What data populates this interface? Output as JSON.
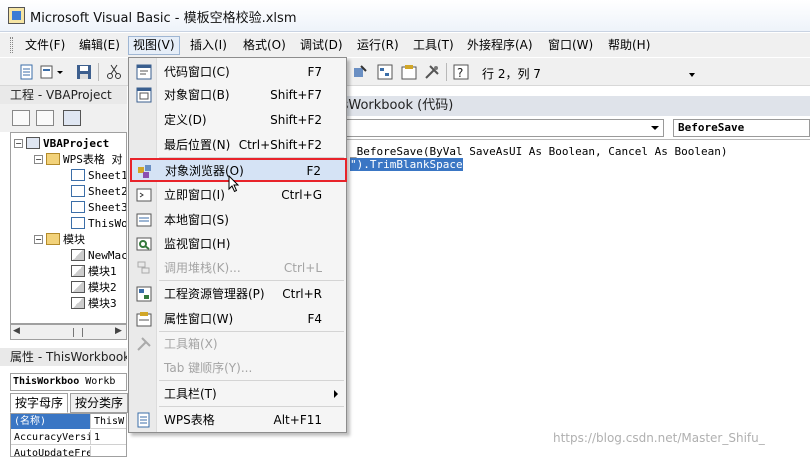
{
  "window": {
    "title": "Microsoft Visual Basic - 模板空格校验.xlsm"
  },
  "menubar": [
    {
      "label": "文件(F)"
    },
    {
      "label": "编辑(E)"
    },
    {
      "label": "视图(V)"
    },
    {
      "label": "插入(I)"
    },
    {
      "label": "格式(O)"
    },
    {
      "label": "调试(D)"
    },
    {
      "label": "运行(R)"
    },
    {
      "label": "工具(T)"
    },
    {
      "label": "外接程序(A)"
    },
    {
      "label": "窗口(W)"
    },
    {
      "label": "帮助(H)"
    }
  ],
  "toolbar": {
    "position_text": "行 2，列 7"
  },
  "project_panel": {
    "title": "工程 - VBAProject",
    "tree": [
      {
        "label": "VBAProject"
      },
      {
        "label": "WPS表格 对"
      },
      {
        "label": "Sheet1"
      },
      {
        "label": "Sheet2"
      },
      {
        "label": "Sheet3"
      },
      {
        "label": "ThisWo"
      },
      {
        "label": "模块"
      },
      {
        "label": "NewMac"
      },
      {
        "label": "模块1"
      },
      {
        "label": "模块2"
      },
      {
        "label": "模块3"
      }
    ]
  },
  "properties_panel": {
    "title": "属性 - ThisWorkbook",
    "object_name": "ThisWorkboo",
    "object_type": "Workb",
    "tabs": [
      "按字母序",
      "按分类序"
    ],
    "rows": [
      {
        "key": "(名称)",
        "value": "ThisW"
      },
      {
        "key": "AccuracyVersi",
        "value": "1"
      },
      {
        "key": "AutoUpdateFreQ",
        "value": ""
      }
    ]
  },
  "code_window": {
    "title": "isWorkbook (代码)",
    "object_combo": "",
    "procedure_combo": "BeforeSave",
    "lines": [
      "_BeforeSave(ByVal SaveAsUI As Boolean, Cancel As Boolean)",
      "\").TrimBlankSpace"
    ]
  },
  "view_menu": {
    "items": [
      {
        "label": "代码窗口(C)",
        "shortcut": "F7",
        "icon": "code-window-icon"
      },
      {
        "label": "对象窗口(B)",
        "shortcut": "Shift+F7",
        "icon": "object-window-icon"
      },
      {
        "label": "定义(D)",
        "shortcut": "Shift+F2",
        "icon": ""
      },
      {
        "label": "最后位置(N)",
        "shortcut": "Ctrl+Shift+F2",
        "icon": ""
      },
      {
        "label": "对象浏览器(O)",
        "shortcut": "F2",
        "icon": "object-browser-icon"
      },
      {
        "label": "立即窗口(I)",
        "shortcut": "Ctrl+G",
        "icon": "immediate-window-icon"
      },
      {
        "label": "本地窗口(S)",
        "shortcut": "",
        "icon": "locals-window-icon"
      },
      {
        "label": "监视窗口(H)",
        "shortcut": "",
        "icon": "watch-window-icon"
      },
      {
        "label": "调用堆栈(K)...",
        "shortcut": "Ctrl+L",
        "icon": "call-stack-icon"
      },
      {
        "label": "工程资源管理器(P)",
        "shortcut": "Ctrl+R",
        "icon": "project-explorer-icon"
      },
      {
        "label": "属性窗口(W)",
        "shortcut": "F4",
        "icon": "properties-window-icon"
      },
      {
        "label": "工具箱(X)",
        "shortcut": "",
        "icon": "toolbox-icon"
      },
      {
        "label": "Tab 键顺序(Y)...",
        "shortcut": "",
        "icon": ""
      },
      {
        "label": "工具栏(T)",
        "shortcut": "",
        "icon": ""
      },
      {
        "label": "WPS表格",
        "shortcut": "Alt+F11",
        "icon": "wps-sheet-icon"
      }
    ]
  },
  "watermark": "https://blog.csdn.net/Master_Shifu_",
  "colors": {
    "highlight": "#d5e3f5",
    "selection_outline": "#e8232a",
    "code_selection": "#3a76c4"
  }
}
